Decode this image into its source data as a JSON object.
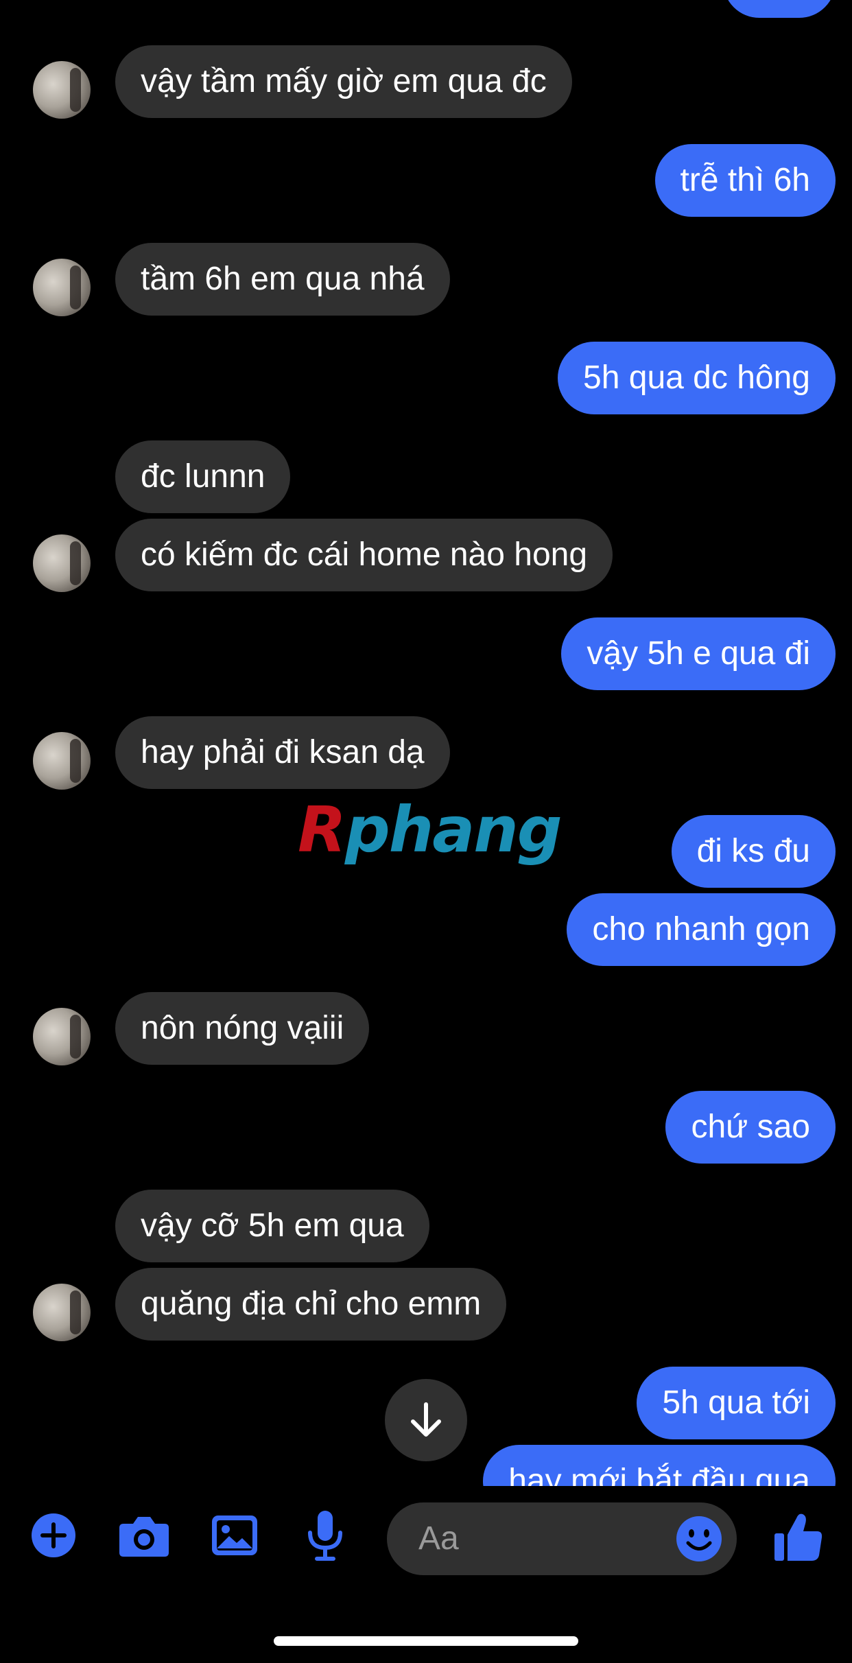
{
  "colors": {
    "background": "#000000",
    "incoming_bubble": "#303030",
    "outgoing_bubble": "#3b6cf7",
    "accent": "#3b6cf7",
    "text": "#ffffff",
    "placeholder": "#9a9a9a"
  },
  "messages": [
    {
      "side": "outgoing",
      "text": ""
    },
    {
      "side": "incoming",
      "text": "vậy tầm mấy giờ em qua đc"
    },
    {
      "side": "outgoing",
      "text": "trễ thì 6h"
    },
    {
      "side": "incoming",
      "text": "tầm 6h em qua nhá"
    },
    {
      "side": "outgoing",
      "text": "5h qua dc hông"
    },
    {
      "side": "incoming",
      "text": "đc lunnn"
    },
    {
      "side": "incoming",
      "text": "có kiếm đc cái home nào hong"
    },
    {
      "side": "outgoing",
      "text": "vậy 5h e qua đi"
    },
    {
      "side": "incoming",
      "text": "hay phải đi ksan dạ"
    },
    {
      "side": "outgoing",
      "text": "đi ks đu"
    },
    {
      "side": "outgoing",
      "text": "cho nhanh gọn"
    },
    {
      "side": "incoming",
      "text": "nôn nóng vạiii"
    },
    {
      "side": "outgoing",
      "text": "chứ sao"
    },
    {
      "side": "incoming",
      "text": "vậy cỡ 5h em qua"
    },
    {
      "side": "incoming",
      "text": "quăng địa chỉ cho emm"
    },
    {
      "side": "outgoing",
      "text": "5h qua tới"
    },
    {
      "side": "outgoing",
      "text": "hay mới bắt đầu qua"
    }
  ],
  "watermark": {
    "first": "R",
    "rest": "phang"
  },
  "composer": {
    "placeholder": "Aa",
    "icons": [
      "plus-icon",
      "camera-icon",
      "gallery-icon",
      "microphone-icon",
      "emoji-icon",
      "thumbs-up-icon"
    ]
  }
}
